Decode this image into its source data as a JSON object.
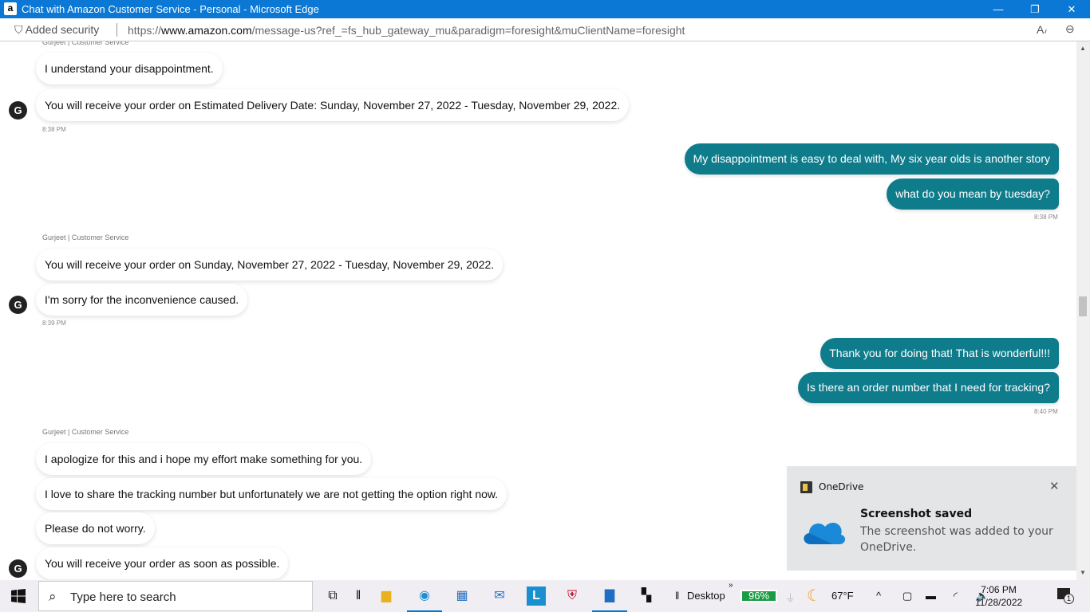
{
  "window": {
    "title": "Chat with Amazon Customer Service - Personal - Microsoft Edge",
    "minimize": "—",
    "restore": "❐",
    "close": "✕"
  },
  "address_bar": {
    "security": "Added security",
    "url_prefix": "https://",
    "url_domain": "www.amazon.com",
    "url_path": "/message-us?ref_=fs_hub_gateway_mu&paradigm=foresight&muClientName=foresight"
  },
  "chat": {
    "agent_label": "Gurjeet | Customer Service",
    "avatar_letter": "G",
    "groups": [
      {
        "messages": [
          "I understand your disappointment.",
          "You will receive your order on Estimated Delivery Date: Sunday, November 27, 2022 - Tuesday, November 29, 2022."
        ],
        "time": "8:38 PM"
      },
      {
        "messages": [
          "My disappointment is easy to deal with, My six year olds is another story",
          "what do you mean by tuesday?"
        ],
        "time": "8:38 PM"
      },
      {
        "messages": [
          "You will receive your order on Sunday, November 27, 2022 - Tuesday, November 29, 2022.",
          "I'm sorry for the inconvenience caused."
        ],
        "time": "8:39 PM"
      },
      {
        "messages": [
          "Thank you for doing that! That is wonderful!!!",
          "Is there an order number that I need for tracking?"
        ],
        "time": "8:40 PM"
      },
      {
        "messages": [
          "I apologize for this and i hope my effort make something for you.",
          "I love to share the tracking number but unfortunately we are not getting the option right now.",
          "Please do not worry.",
          "You will receive your order as soon as possible."
        ]
      }
    ]
  },
  "toast": {
    "app": "OneDrive",
    "title": "Screenshot saved",
    "body": "The screenshot was added to your OneDrive."
  },
  "taskbar": {
    "search_placeholder": "Type here to search",
    "desktop": "Desktop",
    "battery": "96%",
    "weather": "67°F",
    "time": "7:06 PM",
    "date": "11/28/2022",
    "notifications": "1"
  },
  "colors": {
    "titlebar": "#0a78d4",
    "user_bubble": "#0f7c8c"
  }
}
